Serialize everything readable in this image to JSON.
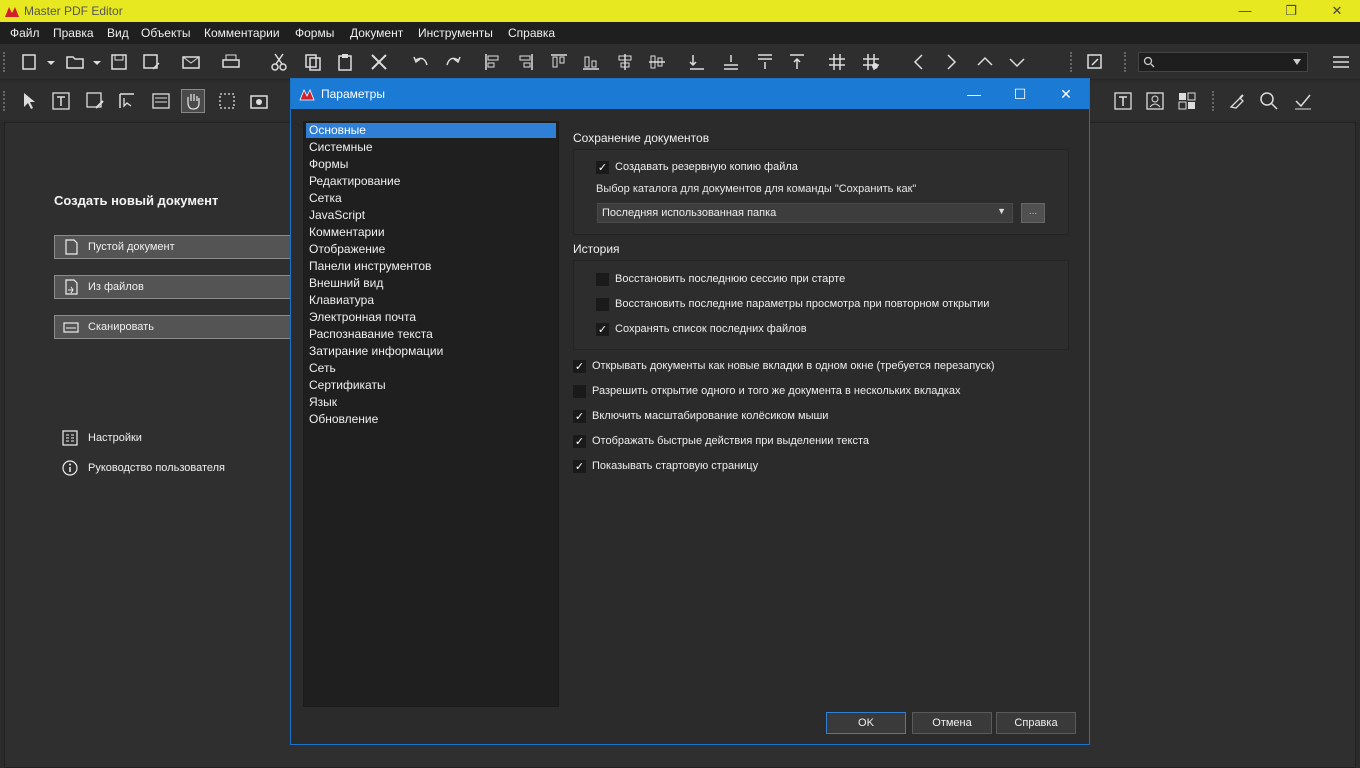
{
  "window": {
    "title": "Master PDF Editor",
    "brand_color": "#e8e820"
  },
  "menu": [
    "Файл",
    "Правка",
    "Вид",
    "Объекты",
    "Комментарии",
    "Формы",
    "Документ",
    "Инструменты",
    "Справка"
  ],
  "start_page": {
    "title": "Создать новый документ",
    "buttons": [
      {
        "label": "Пустой документ",
        "icon": "blank-document-icon"
      },
      {
        "label": "Из файлов",
        "icon": "from-files-icon"
      },
      {
        "label": "Сканировать",
        "icon": "scanner-icon"
      }
    ],
    "links": [
      {
        "label": "Настройки",
        "icon": "settings-icon"
      },
      {
        "label": "Руководство пользователя",
        "icon": "info-icon"
      }
    ]
  },
  "dialog": {
    "title": "Параметры",
    "nav_items": [
      "Основные",
      "Системные",
      "Формы",
      "Редактирование",
      "Сетка",
      "JavaScript",
      "Комментарии",
      "Отображение",
      "Панели инструментов",
      "Внешний вид",
      "Клавиатура",
      "Электронная почта",
      "Распознавание текста",
      "Затирание информации",
      "Сеть",
      "Сертификаты",
      "Язык",
      "Обновление"
    ],
    "selected_nav": "Основные",
    "save_group": {
      "label": "Сохранение документов",
      "backup": {
        "label": "Создавать резервную копию файла",
        "checked": true
      },
      "folder_label": "Выбор каталога для документов для команды \"Сохранить как\"",
      "folder_value": "Последняя использованная папка",
      "browse_label": "..."
    },
    "history_group": {
      "label": "История",
      "options": [
        {
          "label": "Восстановить последнюю сессию при старте",
          "checked": false
        },
        {
          "label": "Восстановить последние параметры просмотра при повторном открытии",
          "checked": false
        },
        {
          "label": "Сохранять список последних файлов",
          "checked": true
        }
      ]
    },
    "general_options": [
      {
        "label": "Открывать документы как новые вкладки в одном окне (требуется перезапуск)",
        "checked": true
      },
      {
        "label": "Разрешить открытие одного и того же документа в нескольких вкладках",
        "checked": false
      },
      {
        "label": "Включить масштабирование колёсиком мыши",
        "checked": true
      },
      {
        "label": "Отображать быстрые действия при выделении текста",
        "checked": true
      },
      {
        "label": "Показывать стартовую страницу",
        "checked": true
      }
    ],
    "buttons": {
      "ok": "OK",
      "cancel": "Отмена",
      "help": "Справка"
    },
    "accent": "#1a7ad4"
  }
}
